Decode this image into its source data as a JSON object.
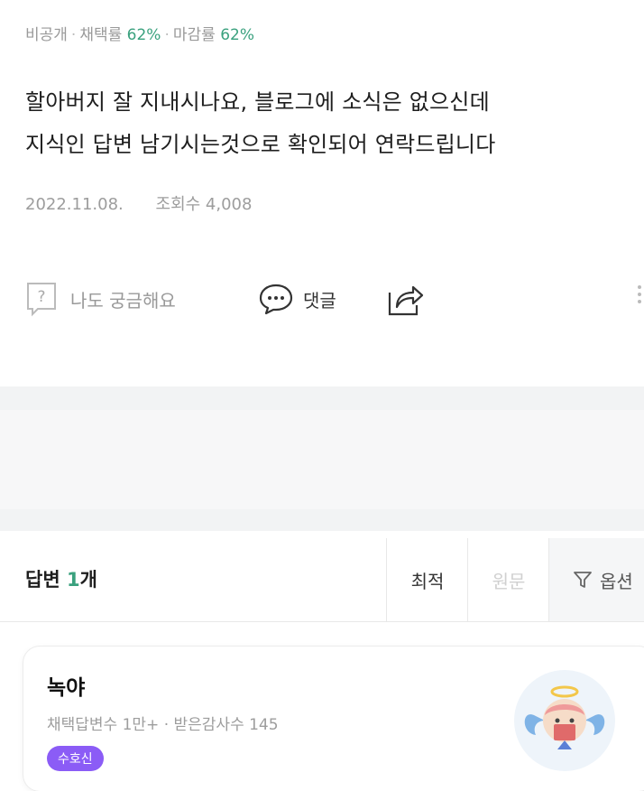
{
  "question_meta": {
    "visibility": "비공개",
    "adopt_label": "채택률",
    "adopt_rate": "62%",
    "close_label": "마감률",
    "close_rate": "62%"
  },
  "question": {
    "line1": "할아버지 잘 지내시나요, 블로그에 소식은 없으신데",
    "line2": "지식인 답변 남기시는것으로 확인되어 연락드립니다",
    "date": "2022.11.08.",
    "views": "조회수 4,008"
  },
  "actions": {
    "curious": "나도 궁금해요",
    "comment": "댓글"
  },
  "answers": {
    "title": "답변",
    "count": "1",
    "count_suffix": "개",
    "sort_latest": "최적",
    "sort_original": "원문",
    "option": "옵션"
  },
  "answer_card": {
    "author": "녹야",
    "stats": "채택답변수 1만+ · 받은감사수 145",
    "badge": "수호신"
  },
  "colors": {
    "accent_green": "#3aa17e",
    "badge_purple": "#8b5cf6"
  }
}
